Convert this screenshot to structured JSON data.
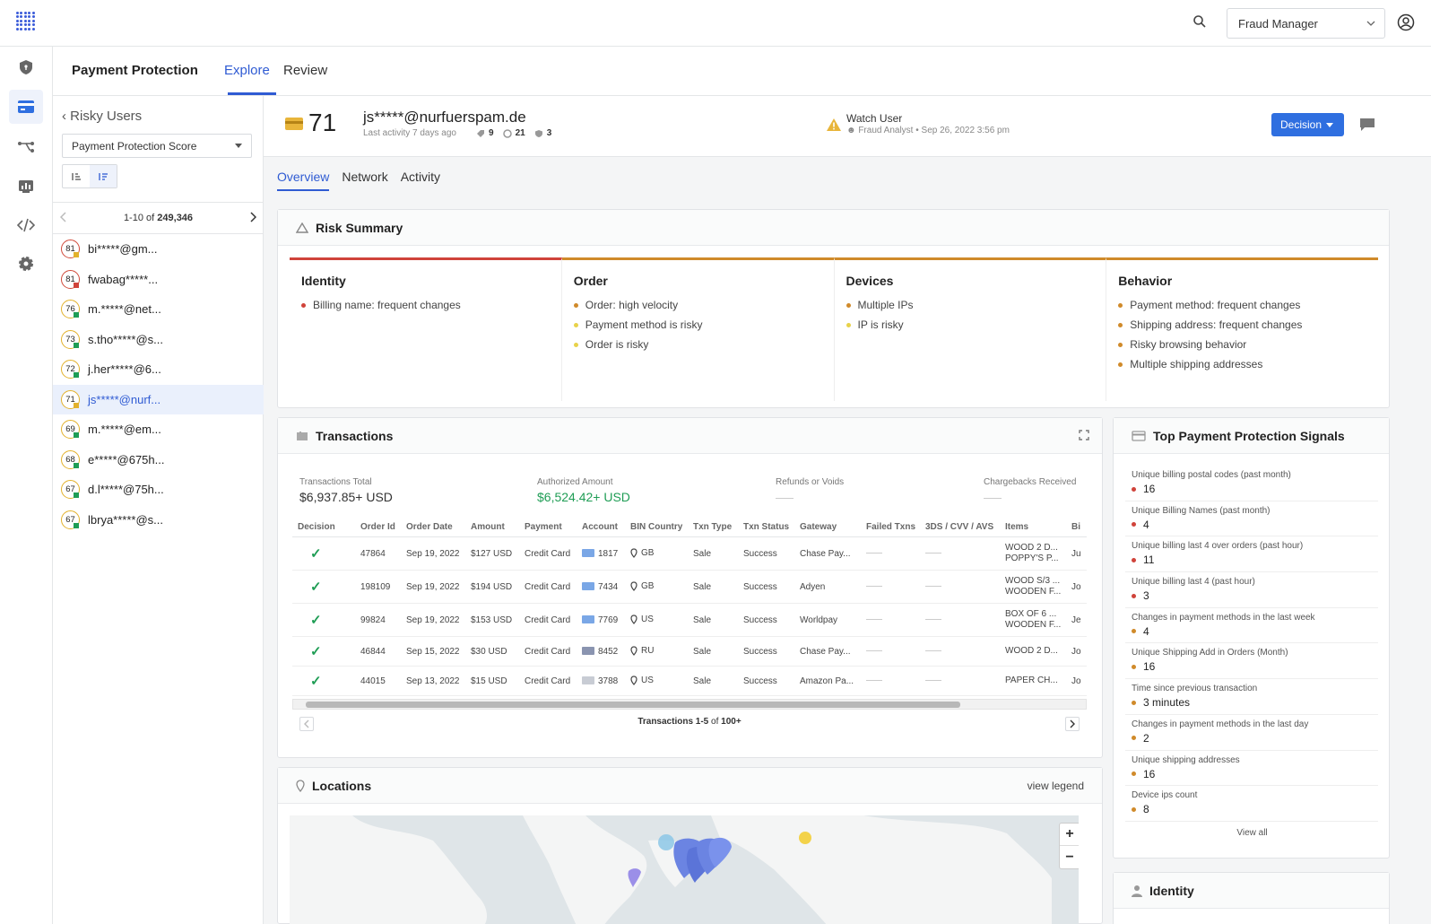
{
  "topbar": {
    "role_select": "Fraud Manager"
  },
  "header": {
    "app_title": "Payment Protection",
    "tabs": [
      "Explore",
      "Review"
    ]
  },
  "left_panel": {
    "back_label": "Risky Users",
    "score_select": "Payment Protection Score",
    "pager": {
      "range": "1-10",
      "of": "of",
      "total": "249,346"
    },
    "users": [
      {
        "score": "81",
        "name": "bi*****@gm...",
        "ring": "#d04a3a",
        "dot": "#e2b12c"
      },
      {
        "score": "81",
        "name": "fwabag*****...",
        "ring": "#d04a3a",
        "dot": "#d0433a"
      },
      {
        "score": "76",
        "name": "m.*****@net...",
        "ring": "#e2b12c",
        "dot": "#1f9d55"
      },
      {
        "score": "73",
        "name": "s.tho*****@s...",
        "ring": "#e2b12c",
        "dot": "#1f9d55"
      },
      {
        "score": "72",
        "name": "j.her*****@6...",
        "ring": "#e2b12c",
        "dot": "#1f9d55"
      },
      {
        "score": "71",
        "name": "js*****@nurf...",
        "ring": "#e2b12c",
        "dot": "#e2b12c"
      },
      {
        "score": "69",
        "name": "m.*****@em...",
        "ring": "#e2b12c",
        "dot": "#1f9d55"
      },
      {
        "score": "68",
        "name": "e*****@675h...",
        "ring": "#e2b12c",
        "dot": "#1f9d55"
      },
      {
        "score": "67",
        "name": "d.l*****@75h...",
        "ring": "#e2b12c",
        "dot": "#1f9d55"
      },
      {
        "score": "67",
        "name": "lbrya*****@s...",
        "ring": "#e2b12c",
        "dot": "#1f9d55"
      }
    ]
  },
  "user": {
    "score": "71",
    "email": "js*****@nurfuerspam.de",
    "last_activity": "Last activity 7 days ago",
    "stats": [
      "9",
      "21",
      "3"
    ],
    "watch_title": "Watch User",
    "watch_by": "Fraud Analyst",
    "watch_date": "Sep 26, 2022 3:56 pm",
    "decision_label": "Decision"
  },
  "subtabs": [
    "Overview",
    "Network",
    "Activity"
  ],
  "risk_summary": {
    "title": "Risk Summary",
    "columns": [
      {
        "title": "Identity",
        "items": [
          {
            "text": "Billing name: frequent changes",
            "color": "#d0433a"
          }
        ]
      },
      {
        "title": "Order",
        "items": [
          {
            "text": "Order: high velocity",
            "color": "#d08a2a"
          },
          {
            "text": "Payment method is risky",
            "color": "#e8d24a"
          },
          {
            "text": "Order is risky",
            "color": "#e8d24a"
          }
        ]
      },
      {
        "title": "Devices",
        "items": [
          {
            "text": "Multiple IPs",
            "color": "#d08a2a"
          },
          {
            "text": "IP is risky",
            "color": "#e8d24a"
          }
        ]
      },
      {
        "title": "Behavior",
        "items": [
          {
            "text": "Payment method: frequent changes",
            "color": "#d08a2a"
          },
          {
            "text": "Shipping address: frequent changes",
            "color": "#d08a2a"
          },
          {
            "text": "Risky browsing behavior",
            "color": "#d08a2a"
          },
          {
            "text": "Multiple shipping addresses",
            "color": "#d08a2a"
          }
        ]
      }
    ]
  },
  "transactions": {
    "title": "Transactions",
    "summary": [
      {
        "label": "Transactions Total",
        "value": "$6,937.85+ USD"
      },
      {
        "label": "Authorized Amount",
        "value": "$6,524.42+ USD"
      },
      {
        "label": "Refunds or Voids",
        "value": ""
      },
      {
        "label": "Chargebacks Received",
        "value": ""
      }
    ],
    "headers": [
      "Decision",
      "Order Id",
      "Order Date",
      "Amount",
      "Payment",
      "Account",
      "BIN Country",
      "Txn Type",
      "Txn Status",
      "Gateway",
      "Failed Txns",
      "3DS / CVV / AVS",
      "Items",
      "Bi"
    ],
    "rows": [
      {
        "order_id": "47864",
        "date": "Sep 19, 2022",
        "amount": "$127 USD",
        "payment": "Credit Card",
        "account": "1817",
        "country": "GB",
        "type": "Sale",
        "status": "Success",
        "gateway": "Chase Pay...",
        "items1": "WOOD 2 D...",
        "items2": "POPPY'S P...",
        "bi": "Ju"
      },
      {
        "order_id": "198109",
        "date": "Sep 19, 2022",
        "amount": "$194 USD",
        "payment": "Credit Card",
        "account": "7434",
        "country": "GB",
        "type": "Sale",
        "status": "Success",
        "gateway": "Adyen",
        "items1": "WOOD S/3 ...",
        "items2": "WOODEN F...",
        "bi": "Jo"
      },
      {
        "order_id": "99824",
        "date": "Sep 19, 2022",
        "amount": "$153 USD",
        "payment": "Credit Card",
        "account": "7769",
        "country": "US",
        "type": "Sale",
        "status": "Success",
        "gateway": "Worldpay",
        "items1": "BOX OF 6 ...",
        "items2": "WOODEN F...",
        "bi": "Je"
      },
      {
        "order_id": "46844",
        "date": "Sep 15, 2022",
        "amount": "$30 USD",
        "payment": "Credit Card",
        "account": "8452",
        "country": "RU",
        "type": "Sale",
        "status": "Success",
        "gateway": "Chase Pay...",
        "items1": "WOOD 2 D...",
        "items2": "",
        "bi": "Jo"
      },
      {
        "order_id": "44015",
        "date": "Sep 13, 2022",
        "amount": "$15 USD",
        "payment": "Credit Card",
        "account": "3788",
        "country": "US",
        "type": "Sale",
        "status": "Success",
        "gateway": "Amazon Pa...",
        "items1": "PAPER CH...",
        "items2": "",
        "bi": "Jo"
      }
    ],
    "pager": {
      "range": "Transactions 1-5",
      "of": "of",
      "total": "100+"
    }
  },
  "signals": {
    "title": "Top Payment Protection Signals",
    "items": [
      {
        "title": "Unique billing postal codes (past month)",
        "value": "16",
        "color": "#d0433a"
      },
      {
        "title": "Unique Billing Names (past month)",
        "value": "4",
        "color": "#d0433a"
      },
      {
        "title": "Unique billing last 4 over orders (past hour)",
        "value": "11",
        "color": "#d0433a"
      },
      {
        "title": "Unique billing last 4 (past hour)",
        "value": "3",
        "color": "#d0433a"
      },
      {
        "title": "Changes in payment methods in the last week",
        "value": "4",
        "color": "#d08a2a"
      },
      {
        "title": "Unique Shipping Add in Orders (Month)",
        "value": "16",
        "color": "#d08a2a"
      },
      {
        "title": "Time since previous transaction",
        "value": "3 minutes",
        "color": "#d08a2a"
      },
      {
        "title": "Changes in payment methods in the last day",
        "value": "2",
        "color": "#d08a2a"
      },
      {
        "title": "Unique shipping addresses",
        "value": "16",
        "color": "#d08a2a"
      },
      {
        "title": "Device ips count",
        "value": "8",
        "color": "#d08a2a"
      }
    ],
    "view_all": "View all"
  },
  "locations": {
    "title": "Locations",
    "view_legend": "view legend",
    "zoom_in": "+",
    "zoom_out": "−"
  },
  "identity": {
    "title": "Identity"
  }
}
